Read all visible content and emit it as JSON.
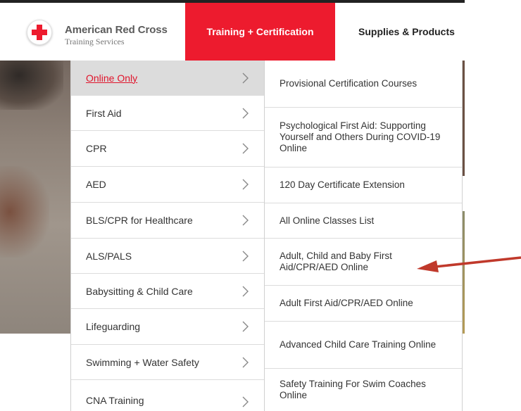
{
  "header": {
    "brand_name": "American Red Cross",
    "brand_sub": "Training Services",
    "nav": {
      "active": "Training + Certification",
      "next": "Supplies & Products"
    }
  },
  "menu": {
    "items": [
      {
        "label": "Online Only",
        "active": true
      },
      {
        "label": "First Aid"
      },
      {
        "label": "CPR"
      },
      {
        "label": "AED"
      },
      {
        "label": "BLS/CPR for Healthcare"
      },
      {
        "label": "ALS/PALS"
      },
      {
        "label": "Babysitting & Child Care"
      },
      {
        "label": "Lifeguarding"
      },
      {
        "label": "Swimming + Water Safety"
      },
      {
        "label": "CNA Training"
      }
    ]
  },
  "submenu": {
    "items": [
      {
        "label": "Provisional Certification Courses"
      },
      {
        "label": "Psychological First Aid: Supporting Yourself and Others During COVID-19 Online"
      },
      {
        "label": "120 Day Certificate Extension"
      },
      {
        "label": "All Online Classes List"
      },
      {
        "label": "Adult, Child and Baby First Aid/CPR/AED Online"
      },
      {
        "label": "Adult First Aid/CPR/AED Online"
      },
      {
        "label": "Advanced Child Care Training Online"
      },
      {
        "label": "Safety Training For Swim Coaches Online"
      }
    ]
  },
  "colors": {
    "brand_red": "#ed1b2e",
    "active_link": "#e0142b",
    "annotation_arrow": "#c0392b"
  },
  "icons": {
    "row_chevron": "chevron-right-icon",
    "logo": "red-cross-icon",
    "annotation": "arrow-left-icon"
  }
}
